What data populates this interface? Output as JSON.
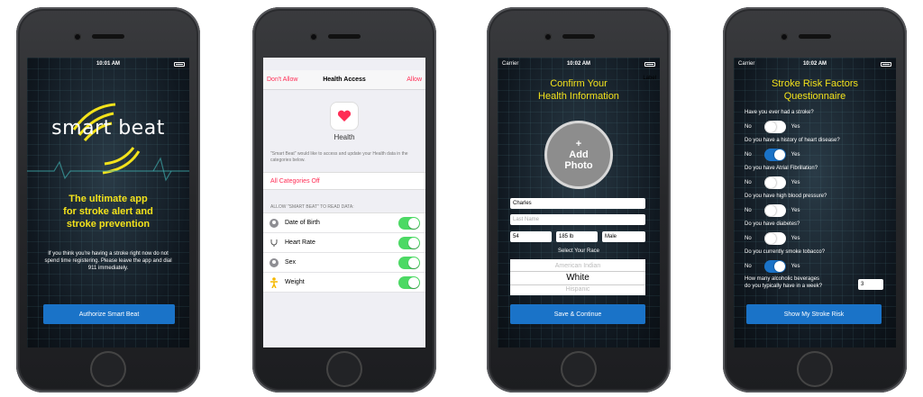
{
  "colors": {
    "accent": "#f3e21b",
    "button": "#1a73c8",
    "health_red": "#ff2d55",
    "toggle_green": "#4cd964"
  },
  "screen1": {
    "status": {
      "carrier": "",
      "time": "10:01 AM"
    },
    "logo": "smart beat",
    "tagline": [
      "The ultimate app",
      "for stroke alert and",
      "stroke prevention"
    ],
    "info": "If you think you're having a stroke right now do not spend time registering. Please leave the app and dial 911 immediately.",
    "button": "Authorize Smart Beat"
  },
  "screen2": {
    "status": {
      "time": ""
    },
    "nav": {
      "left": "Don't Allow",
      "title": "Health Access",
      "right": "Allow"
    },
    "app_name": "Health",
    "description": "\"Smart Beat\" would like to access and update your Health data in the categories below.",
    "all_categories": "All Categories Off",
    "allow_header": "ALLOW \"SMART BEAT\" TO READ DATA:",
    "rows": [
      {
        "label": "Date of Birth",
        "icon": "person-icon"
      },
      {
        "label": "Heart Rate",
        "icon": "stethoscope-icon"
      },
      {
        "label": "Sex",
        "icon": "person-icon"
      },
      {
        "label": "Weight",
        "icon": "figure-icon"
      }
    ]
  },
  "screen3": {
    "status": {
      "carrier": "Carrier",
      "time": "10:02 AM"
    },
    "label_corner": "Label",
    "title": [
      "Confirm Your",
      "Health Information"
    ],
    "photo": [
      "+",
      "Add",
      "Photo"
    ],
    "first_name": "Charles",
    "last_name_placeholder": "Last Name",
    "age": "54",
    "weight": "185 lb",
    "sex": "Male",
    "select_race": "Select Your Race",
    "race_options": [
      "American Indian",
      "White",
      "Hispanic"
    ],
    "button": "Save & Continue"
  },
  "screen4": {
    "status": {
      "carrier": "Carrier",
      "time": "10:02 AM"
    },
    "title": [
      "Stroke Risk Factors",
      "Questionnaire"
    ],
    "no": "No",
    "yes": "Yes",
    "questions": [
      {
        "text": "Have you ever had a stroke?",
        "answer": false
      },
      {
        "text": "Do you have a history of heart disease?",
        "answer": true
      },
      {
        "text": "Do you have Atrial Fibrillation?",
        "answer": false
      },
      {
        "text": "Do you have high blood pressure?",
        "answer": false
      },
      {
        "text": "Do you have diabetes?",
        "answer": false
      },
      {
        "text": "Do you currently smoke tobacco?",
        "answer": true
      }
    ],
    "alcohol": [
      "How many alcoholic beverages",
      "do you typically have in a week?"
    ],
    "alcohol_value": "3",
    "button": "Show My Stroke Risk"
  }
}
